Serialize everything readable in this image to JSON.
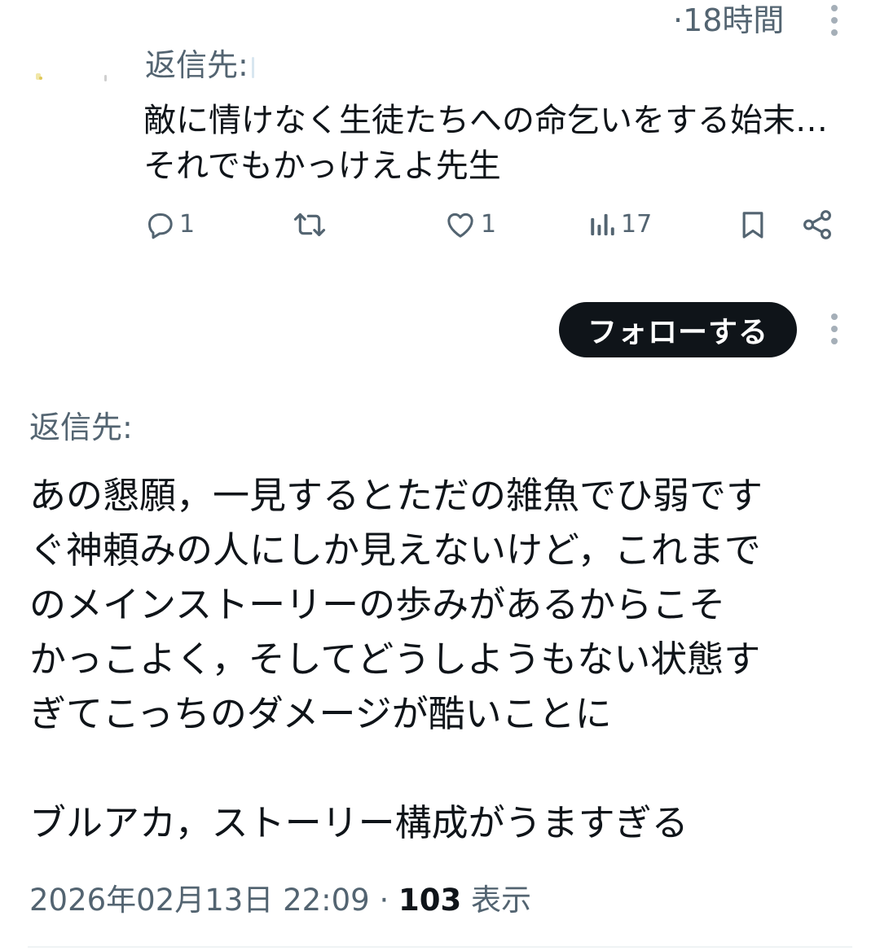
{
  "reply_tweet": {
    "time": "·18時間",
    "reply_to_label": "返信先:",
    "body_lines": [
      "敵に情けなく生徒たちへの命乞いをする始末…",
      "それでもかっけえよ先生"
    ],
    "actions": {
      "reply_icon": "reply-icon",
      "reply_count": "1",
      "retweet_icon": "retweet-icon",
      "like_icon": "heart-icon",
      "like_count": "1",
      "views_icon": "views-icon",
      "views_count": "17",
      "bookmark_icon": "bookmark-icon",
      "share_icon": "share-icon"
    }
  },
  "follow_button": {
    "label": "フォローする"
  },
  "main_tweet": {
    "reply_to_label": "返信先:",
    "body_lines": [
      "あの懇願，一見するとただの雑魚でひ弱です",
      "ぐ神頼みの人にしか見えないけど，これまで",
      "のメインストーリーの歩みがあるからこそ",
      "かっこよく，そしてどうしようもない状態す",
      "ぎてこっちのダメージが酷いことに",
      "",
      "ブルアカ，ストーリー構成がうますぎる"
    ],
    "meta": {
      "datetime": "2026年02月13日 22:09",
      "separator": "·",
      "views_count": "103",
      "views_label": "表示"
    }
  },
  "colors": {
    "text_primary": "#0f1419",
    "text_secondary": "#536471",
    "button_bg": "#0f1419",
    "divider": "#eff3f4"
  }
}
